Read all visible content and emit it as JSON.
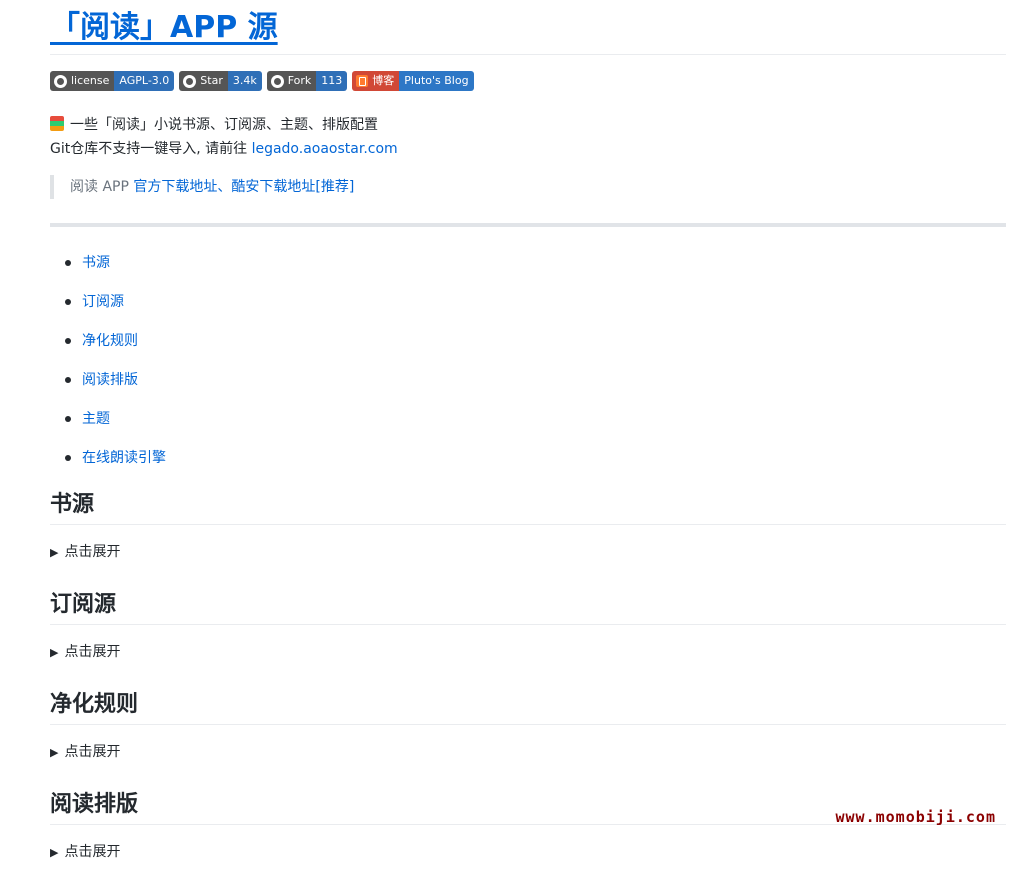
{
  "title": "「阅读」APP 源",
  "badges": [
    {
      "label": "license",
      "value": "AGPL-3.0"
    },
    {
      "label": "Star",
      "value": "3.4k"
    },
    {
      "label": "Fork",
      "value": "113"
    },
    {
      "label": "博客",
      "value": "Pluto's Blog"
    }
  ],
  "description": {
    "line1": "一些「阅读」小说书源、订阅源、主题、排版配置",
    "line2_text": "Git仓库不支持一键导入, 请前往 ",
    "line2_link": "legado.aoaostar.com"
  },
  "quote": {
    "prefix": "阅读 APP ",
    "link1": "官方下载地址",
    "sep": "、",
    "link2": "酷安下载地址[推荐]"
  },
  "toc": [
    "书源",
    "订阅源",
    "净化规则",
    "阅读排版",
    "主题",
    "在线朗读引擎"
  ],
  "sections": [
    {
      "heading": "书源",
      "toggle": "点击展开"
    },
    {
      "heading": "订阅源",
      "toggle": "点击展开"
    },
    {
      "heading": "净化规则",
      "toggle": "点击展开"
    },
    {
      "heading": "阅读排版",
      "toggle": "点击展开"
    }
  ],
  "watermark": "www.momobiji.com"
}
